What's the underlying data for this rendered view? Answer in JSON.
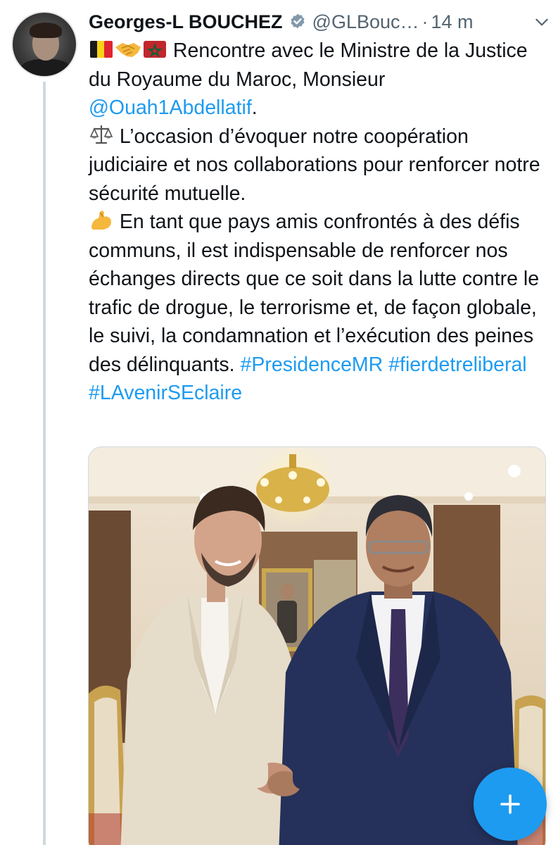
{
  "author": {
    "name": "Georges-L BOUCHEZ",
    "handle": "@GLBouc…",
    "separator": "·",
    "time": "14 m",
    "verified": true
  },
  "tweet": {
    "line1_text": " Rencontre avec le Ministre de la Justice du Royaume du Maroc, Monsieur ",
    "mention": "@Ouah1Abdellatif",
    "mention_suffix": ".",
    "para2": " L’occasion d’évoquer notre coopération judiciaire  et nos collaborations pour renforcer notre sécurité mutuelle.",
    "para3": " En tant que pays amis confrontés à des défis communs, il est indispensable de renforcer nos échanges directs que ce soit dans la lutte contre le trafic de drogue, le terrorisme et, de façon globale, le suivi, la condamnation et l’exécution des peines des délinquants. ",
    "hashtags": [
      "#PresidenceMR",
      "#fierdetreliberal",
      "#LAvenirSEclaire"
    ]
  },
  "emojis": {
    "flag_belgium": "belgium-flag-icon",
    "handshake": "handshake-icon",
    "flag_morocco": "morocco-flag-icon",
    "scales": "balance-scale-icon",
    "muscle": "flexed-biceps-icon"
  },
  "icons": {
    "verified": "verified-badge-icon",
    "more": "chevron-down-icon",
    "compose": "plus-icon"
  },
  "colors": {
    "accent": "#1d9bf0",
    "text": "#0f1419",
    "secondary": "#536471",
    "thread_line": "#cfd9de"
  }
}
